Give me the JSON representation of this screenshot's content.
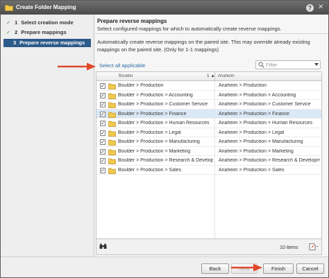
{
  "window": {
    "title": "Create Folder Mapping",
    "help_label": "?",
    "close_label": "✕"
  },
  "steps": [
    {
      "num": "1",
      "label": "Select creation mode",
      "completed": true,
      "active": false
    },
    {
      "num": "2",
      "label": "Prepare mappings",
      "completed": true,
      "active": false
    },
    {
      "num": "3",
      "label": "Prepare reverse mappings",
      "completed": false,
      "active": true
    }
  ],
  "page": {
    "heading": "Prepare reverse mappings",
    "subheading": "Select configured mappings for which to automatically create reverse mappings.",
    "description": "Automatically create reverse mappings on the paired site. This may override already existing mappings on the paired site. (Only for 1-1 mappings)",
    "select_all": "Select all applicable",
    "filter_placeholder": "Filter"
  },
  "grid": {
    "columns": [
      "Boulder",
      "Anaheim"
    ],
    "sort_indicator": "1 ▲",
    "rows": [
      {
        "src": "Boulder > Production",
        "dst": "Anaheim > Production",
        "checked": true,
        "selected": false
      },
      {
        "src": "Boulder > Production > Accounting",
        "dst": "Anaheim > Production > Accounting",
        "checked": true,
        "selected": false
      },
      {
        "src": "Boulder > Production > Customer Service",
        "dst": "Anaheim > Production > Customer Service",
        "checked": true,
        "selected": false
      },
      {
        "src": "Boulder > Production > Finance",
        "dst": "Anaheim > Production > Finance",
        "checked": true,
        "selected": true
      },
      {
        "src": "Boulder > Production > Human Resources",
        "dst": "Anaheim > Production > Human Resources",
        "checked": true,
        "selected": false
      },
      {
        "src": "Boulder > Production > Legal",
        "dst": "Anaheim > Production > Legal",
        "checked": true,
        "selected": false
      },
      {
        "src": "Boulder > Production > Manufacturing",
        "dst": "Anaheim > Production > Manufacturing",
        "checked": true,
        "selected": false
      },
      {
        "src": "Boulder > Production > Marketing",
        "dst": "Anaheim > Production > Marketing",
        "checked": true,
        "selected": false
      },
      {
        "src": "Boulder > Production > Research & Development",
        "dst": "Anaheim > Production > Research & Development",
        "checked": true,
        "selected": false
      },
      {
        "src": "Boulder > Production > Sales",
        "dst": "Anaheim > Production > Sales",
        "checked": true,
        "selected": false
      }
    ],
    "item_count": "10 items"
  },
  "footer": {
    "back": "Back",
    "next": "Next",
    "finish": "Finish",
    "cancel": "Cancel"
  },
  "colors": {
    "active_step": "#2d5b8a",
    "link": "#2e6da4",
    "selected_row": "#dbe8f6",
    "callout_arrow": "#e0472a",
    "check": "#3a9a3a"
  }
}
